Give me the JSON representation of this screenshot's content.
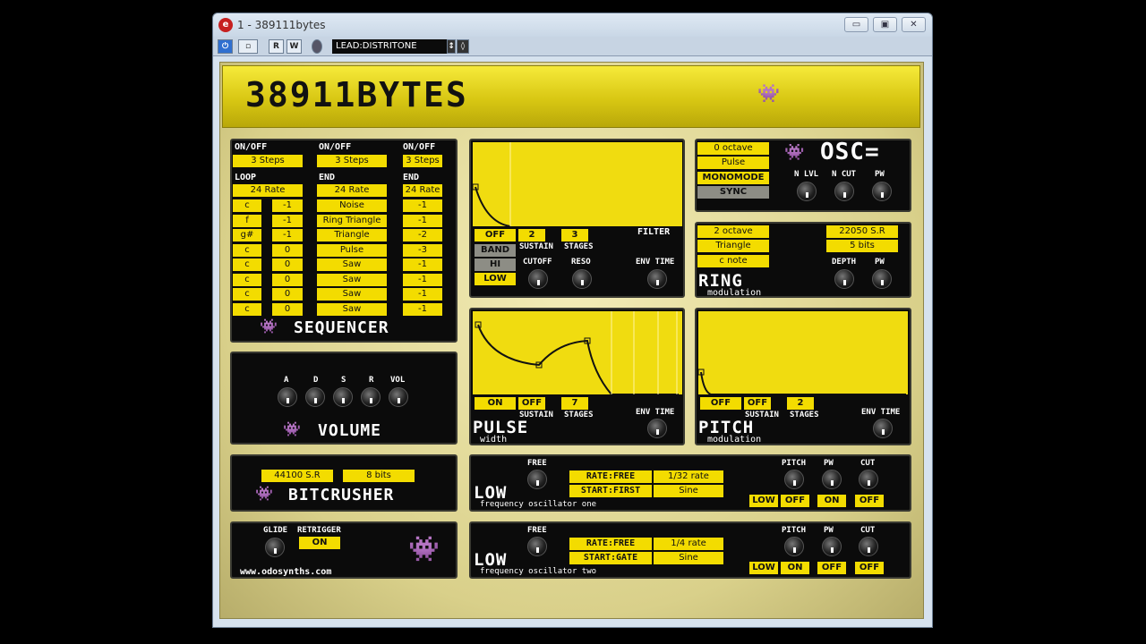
{
  "window": {
    "title": "1 - 389111bytes",
    "min": "▭",
    "max": "▣",
    "close": "✕"
  },
  "toolbar": {
    "power": "⏻",
    "btn2": "▫",
    "r": "R",
    "w": "W",
    "preset": "LEAD:DISTRITONE"
  },
  "logo": "38911BYTES",
  "sequencer": {
    "col_headers": [
      "ON/OFF",
      "ON/OFF",
      "ON/OFF"
    ],
    "steps": [
      "3 Steps",
      "3 Steps",
      "3 Steps"
    ],
    "mid_headers": [
      "LOOP",
      "END",
      "END"
    ],
    "rates": [
      "24 Rate",
      "24 Rate",
      "24 Rate"
    ],
    "rows": [
      [
        "c",
        "-1",
        "Noise",
        "-1"
      ],
      [
        "f",
        "-1",
        "Ring Triangle",
        "-1"
      ],
      [
        "g#",
        "-1",
        "Triangle",
        "-2"
      ],
      [
        "c",
        "0",
        "Pulse",
        "-3"
      ],
      [
        "c",
        "0",
        "Saw",
        "-1"
      ],
      [
        "c",
        "0",
        "Saw",
        "-1"
      ],
      [
        "c",
        "0",
        "Saw",
        "-1"
      ],
      [
        "c",
        "0",
        "Saw",
        "-1"
      ]
    ],
    "title": "SEQUENCER"
  },
  "filter": {
    "title": "FILTER",
    "onoff": "OFF",
    "sustain": "2",
    "stages": "3",
    "sustain_lbl": "SUSTAIN",
    "stages_lbl": "STAGES",
    "band": "BAND",
    "hi": "HI",
    "low": "LOW",
    "cutoff": "CUTOFF",
    "reso": "RESO",
    "envtime": "ENV TIME"
  },
  "osc": {
    "octave": "0 octave",
    "wave": "Pulse",
    "mono": "MONOMODE",
    "sync": "SYNC",
    "title": "OSC=",
    "nlvl": "N LVL",
    "ncut": "N CUT",
    "pw": "PW"
  },
  "ring": {
    "octave": "2 octave",
    "wave": "Triangle",
    "note": "c note",
    "sr": "22050 S.R",
    "bits": "5 bits",
    "depth": "DEPTH",
    "pw": "PW",
    "title": "RING",
    "sub": "modulation"
  },
  "pulse": {
    "onoff": "ON",
    "sustain": "OFF",
    "stages": "7",
    "sustain_lbl": "SUSTAIN",
    "stages_lbl": "STAGES",
    "envtime": "ENV TIME",
    "title": "PULSE",
    "sub": "width"
  },
  "pitch": {
    "onoff": "OFF",
    "sustain": "OFF",
    "stages": "2",
    "sustain_lbl": "SUSTAIN",
    "stages_lbl": "STAGES",
    "envtime": "ENV TIME",
    "title": "PITCH",
    "sub": "modulation"
  },
  "volume": {
    "a": "A",
    "d": "D",
    "s": "S",
    "r": "R",
    "vol": "VOL",
    "title": "VOLUME"
  },
  "bitcrusher": {
    "sr": "44100 S.R",
    "bits": "8 bits",
    "title": "BITCRUSHER"
  },
  "misc": {
    "glide": "GLIDE",
    "retrigger": "RETRIGGER",
    "retrig_val": "ON",
    "url": "www.odosynths.com"
  },
  "lfo1": {
    "free": "FREE",
    "rate_lbl": "RATE:FREE",
    "rate": "1/32 rate",
    "start_lbl": "START:FIRST",
    "start": "Sine",
    "pitch": "PITCH",
    "pw": "PW",
    "cut": "CUT",
    "toggles": [
      "LOW",
      "OFF",
      "ON",
      "OFF"
    ],
    "title": "LOW",
    "sub": "frequency oscillator one"
  },
  "lfo2": {
    "free": "FREE",
    "rate_lbl": "RATE:FREE",
    "rate": "1/4 rate",
    "start_lbl": "START:GATE",
    "start": "Sine",
    "pitch": "PITCH",
    "pw": "PW",
    "cut": "CUT",
    "toggles": [
      "LOW",
      "ON",
      "OFF",
      "OFF"
    ],
    "title": "LOW",
    "sub": "frequency oscillator two"
  }
}
